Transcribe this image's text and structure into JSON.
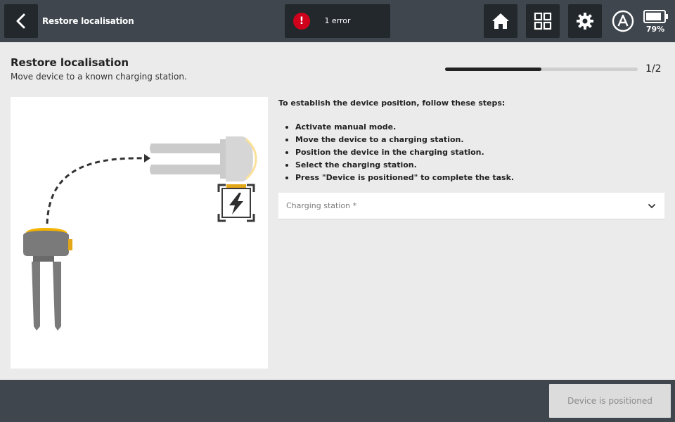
{
  "topbar": {
    "title": "Restore localisation",
    "error_label": "1 error",
    "error_mark": "!",
    "battery_percent": "79%",
    "icons": [
      "back-arrow-icon",
      "home-icon",
      "grid-icon",
      "gear-icon",
      "auto-mode-icon",
      "battery-icon"
    ]
  },
  "header": {
    "title": "Restore localisation",
    "subtitle": "Move device to a known charging station.",
    "step_counter": "1/2",
    "progress": 0.5
  },
  "instructions": {
    "intro": "To establish the device position, follow these steps:",
    "steps": [
      "Activate manual mode.",
      "Move the device to a charging station.",
      "Position the device in the charging station.",
      "Select the charging station.",
      "Press \"Device is positioned\" to complete the task."
    ]
  },
  "charging_select": {
    "placeholder": "Charging station *"
  },
  "footer": {
    "confirm_label": "Device is positioned"
  },
  "colors": {
    "bar": "#3f464d",
    "button": "#23282d",
    "error": "#d0021b",
    "accent": "#f5b400",
    "background": "#ebebeb"
  }
}
